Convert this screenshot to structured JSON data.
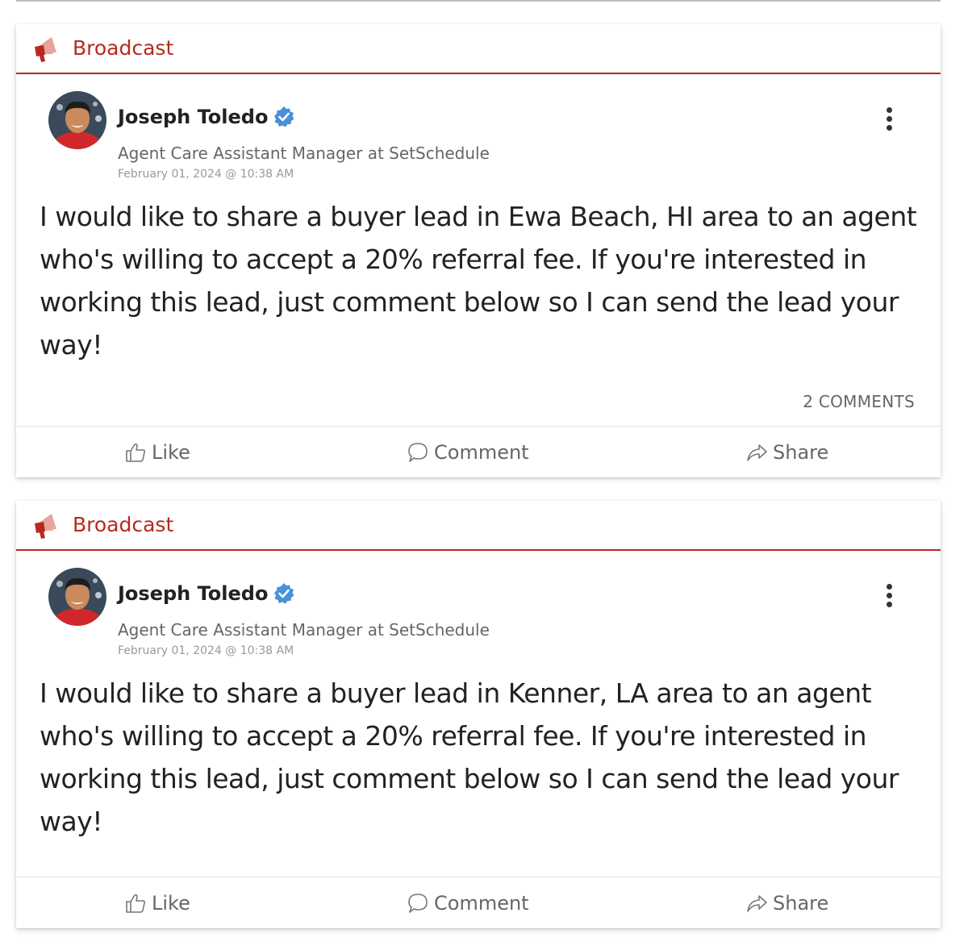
{
  "posts": [
    {
      "category": "Broadcast",
      "author": {
        "name": "Joseph Toledo",
        "title": "Agent Care Assistant Manager at SetSchedule",
        "verified": true
      },
      "date": "February 01, 2024 @ 10:38 AM",
      "body": "I would like to share a buyer lead in Ewa Beach, HI area to an agent who's willing to accept a 20% referral fee. If you're interested in working this lead, just comment below so I can send the lead your way!",
      "comments_label": "2 COMMENTS",
      "actions": {
        "like": "Like",
        "comment": "Comment",
        "share": "Share"
      }
    },
    {
      "category": "Broadcast",
      "author": {
        "name": "Joseph Toledo",
        "title": "Agent Care Assistant Manager at SetSchedule",
        "verified": true
      },
      "date": "February 01, 2024 @ 10:38 AM",
      "body": "I would like to share a buyer lead in Kenner, LA area to an agent who's willing to accept a 20% referral fee. If you're interested in working this lead, just comment below so I can send the lead your way!",
      "actions": {
        "like": "Like",
        "comment": "Comment",
        "share": "Share"
      }
    }
  ],
  "colors": {
    "accent": "#b72a1d",
    "verified": "#4a90d9",
    "muted_text": "#666666",
    "date_text": "#999999"
  },
  "icons": [
    "megaphone-icon",
    "verified-icon",
    "more-vertical-icon",
    "thumbs-up-icon",
    "comment-bubble-icon",
    "share-arrow-icon"
  ]
}
